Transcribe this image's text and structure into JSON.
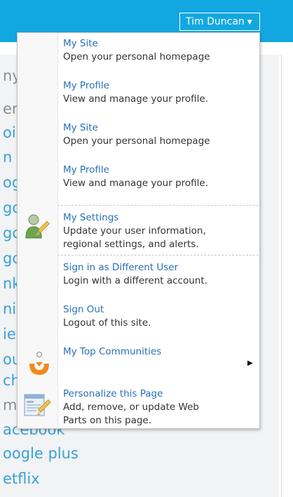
{
  "header": {
    "user_name": "Tim Duncan",
    "caret": "▼"
  },
  "background": {
    "lines": [
      {
        "text": "ny",
        "tone": "gray"
      },
      {
        "text": "er",
        "tone": "gray"
      },
      {
        "text": "oi",
        "tone": "blue"
      },
      {
        "text": "n",
        "tone": "blue"
      },
      {
        "text": "og",
        "tone": "blue"
      },
      {
        "text": "go",
        "tone": "blue"
      },
      {
        "text": "go",
        "tone": "blue"
      },
      {
        "text": "go",
        "tone": "blue"
      },
      {
        "text": "nk",
        "tone": "blue"
      },
      {
        "text": "ni",
        "tone": "blue"
      },
      {
        "text": "ie",
        "tone": "blue"
      },
      {
        "text": "ou",
        "tone": "blue"
      },
      {
        "text": "ch",
        "tone": "blue"
      },
      {
        "text": "me",
        "tone": "gray"
      },
      {
        "text": "acebook",
        "tone": "blue"
      },
      {
        "text": "oogle plus",
        "tone": "blue"
      },
      {
        "text": "etflix",
        "tone": "blue"
      }
    ]
  },
  "menu": {
    "items": [
      {
        "title": "My Site",
        "desc": "Open your personal homepage",
        "icon": ""
      },
      {
        "title": "My Profile",
        "desc": "View and manage your profile.",
        "icon": ""
      },
      {
        "title": "My Site",
        "desc": "Open your personal homepage",
        "icon": ""
      },
      {
        "title": "My Profile",
        "desc": "View and manage your profile.",
        "icon": ""
      },
      {
        "title": "My Settings",
        "desc": "Update your user information,",
        "desc2": "regional settings, and alerts.",
        "icon": "user-settings-icon"
      },
      {
        "title": "Sign in as Different User",
        "desc": "Login with a different account.",
        "icon": ""
      },
      {
        "title": "Sign Out",
        "desc": "Logout of this site.",
        "icon": ""
      },
      {
        "title": "My Top Communities",
        "desc": "",
        "icon": "communities-icon",
        "submenu": "▶"
      },
      {
        "title": "Personalize this Page",
        "desc": "Add, remove, or update Web",
        "desc2": "Parts on this page.",
        "icon": "personalize-page-icon"
      }
    ]
  },
  "colors": {
    "topbar": "#12a7e0",
    "link": "#2a6fb5",
    "text": "#333333",
    "background_link": "#3aa1d8"
  }
}
